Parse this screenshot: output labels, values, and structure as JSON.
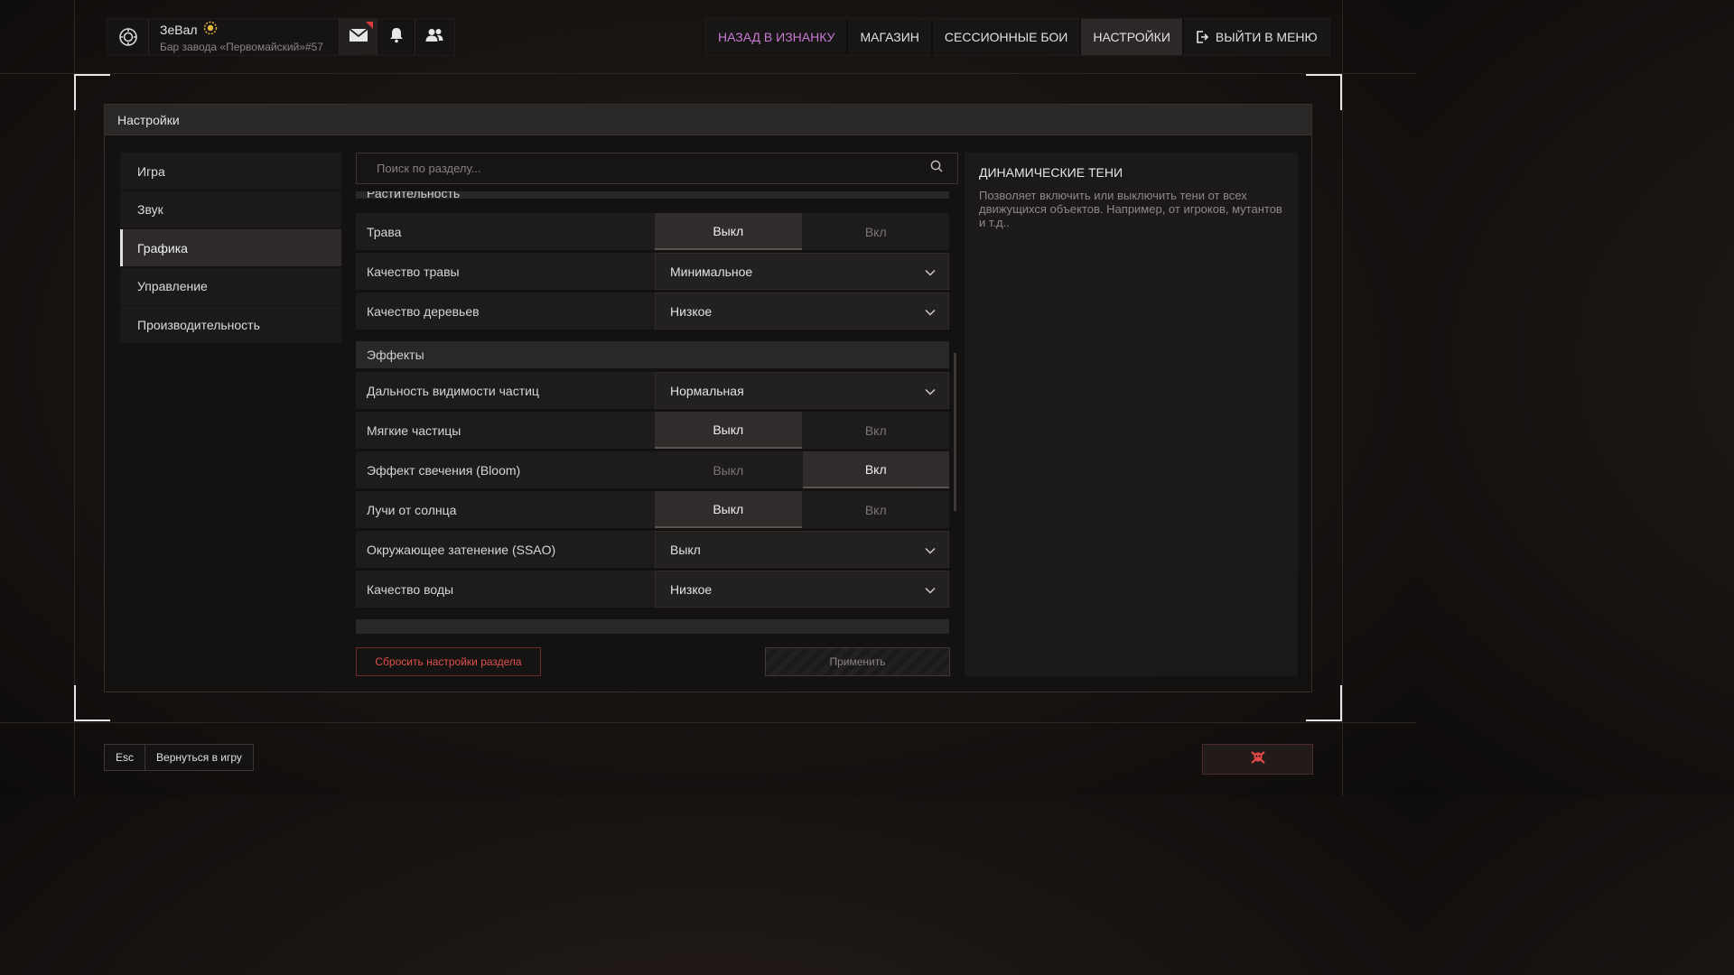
{
  "profile": {
    "name": "ЗеВал",
    "location": "Бар завода «Первомайский»#57",
    "icons": [
      "shield-logo-icon",
      "mail-icon",
      "bell-icon",
      "friends-icon",
      "sun-badge-icon"
    ]
  },
  "topnav": {
    "back": "НАЗАД В ИЗНАНКУ",
    "shop": "МАГАЗИН",
    "sessions": "СЕССИОННЫЕ БОИ",
    "settings": "НАСТРОЙКИ",
    "exit": "ВЫЙТИ В МЕНЮ"
  },
  "panel": {
    "title": "Настройки"
  },
  "sidebar": {
    "items": [
      {
        "label": "Игра"
      },
      {
        "label": "Звук"
      },
      {
        "label": "Графика"
      },
      {
        "label": "Управление"
      },
      {
        "label": "Производительность"
      }
    ]
  },
  "search": {
    "placeholder": "Поиск по разделу..."
  },
  "settings": {
    "section_vegetation": "Растительность",
    "grass": {
      "label": "Трава",
      "off": "Выкл",
      "on": "Вкл",
      "value": "off"
    },
    "grass_quality": {
      "label": "Качество травы",
      "value": "Минимальное"
    },
    "tree_quality": {
      "label": "Качество деревьев",
      "value": "Низкое"
    },
    "section_effects": "Эффекты",
    "particle_distance": {
      "label": "Дальность видимости частиц",
      "value": "Нормальная"
    },
    "soft_particles": {
      "label": "Мягкие частицы",
      "off": "Выкл",
      "on": "Вкл",
      "value": "off"
    },
    "bloom": {
      "label": "Эффект свечения (Bloom)",
      "off": "Выкл",
      "on": "Вкл",
      "value": "on"
    },
    "sun_rays": {
      "label": "Лучи от солнца",
      "off": "Выкл",
      "on": "Вкл",
      "value": "off"
    },
    "ssao": {
      "label": "Окружающее затенение (SSAO)",
      "value": "Выкл"
    },
    "water_quality": {
      "label": "Качество воды",
      "value": "Низкое"
    }
  },
  "buttons": {
    "reset": "Сбросить настройки раздела",
    "apply": "Применить"
  },
  "description": {
    "title": "ДИНАМИЧЕСКИЕ ТЕНИ",
    "text": "Позволяет включить или выключить тени от всех движущихся объектов. Например, от игроков, мутантов и т.д.."
  },
  "footer": {
    "key": "Esc",
    "back_label": "Вернуться в игру"
  },
  "colors": {
    "accent_purple": "#c77ad4",
    "danger_red": "#e0514e"
  }
}
